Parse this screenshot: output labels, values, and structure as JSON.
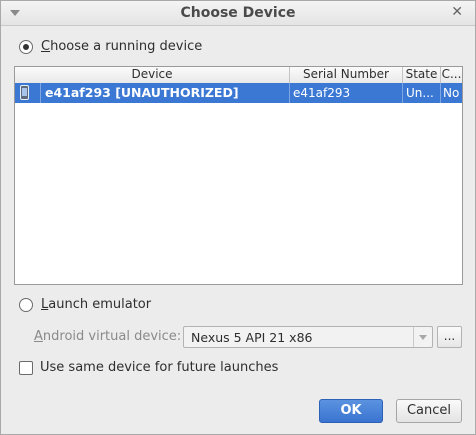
{
  "window": {
    "title": "Choose Device",
    "menu_icon": "chevron-down-icon",
    "close_icon": "close-icon",
    "close_glyph": "✕"
  },
  "running": {
    "mnemonic": "C",
    "label_rest": "hoose a running device",
    "selected": true
  },
  "table": {
    "columns": [
      "Device",
      "Serial Number",
      "State",
      "C..."
    ],
    "rows": [
      {
        "icon": "phone-icon",
        "device": "e41af293 [UNAUTHORIZED]",
        "serial": "e41af293",
        "state": "Un...",
        "compatible": "No",
        "selected": true
      }
    ]
  },
  "emulator": {
    "mnemonic": "L",
    "label_rest": "aunch emulator",
    "selected": false
  },
  "avd": {
    "mnemonic": "A",
    "label_rest": "ndroid virtual device:",
    "value": "Nexus 5 API 21 x86",
    "browse_label": "..."
  },
  "same_device": {
    "label": "Use same device for future launches",
    "checked": false
  },
  "buttons": {
    "ok": "OK",
    "cancel": "Cancel"
  },
  "colors": {
    "selection": "#3a78d4",
    "ok_button": "#3a74d0"
  }
}
